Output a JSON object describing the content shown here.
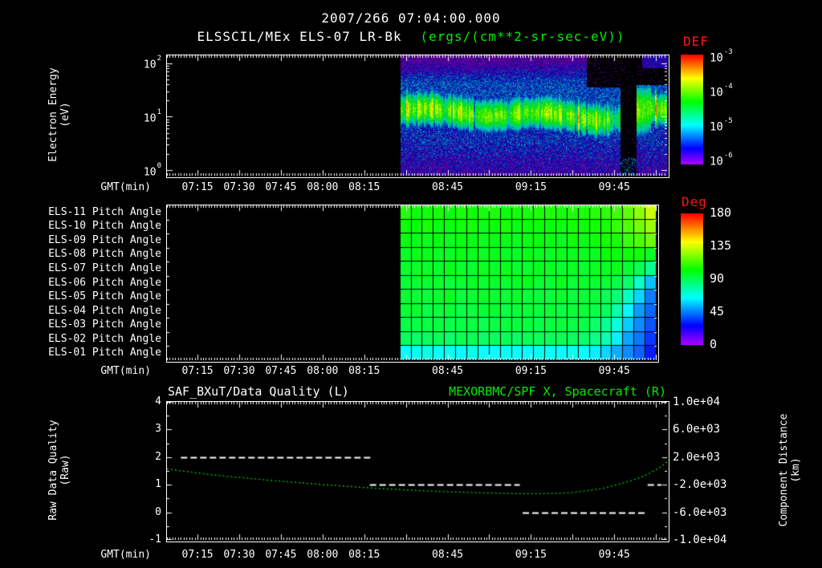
{
  "header": {
    "date_title": "2007/266 07:04:00.000",
    "plot_title": "ELSSCIL/MEx ELS-07 LR-Bk",
    "plot_units": "(ergs/(cm**2-sr-sec-eV))"
  },
  "colors": {
    "white": "#ffffff",
    "green": "#00ee00",
    "red": "#ff1515",
    "curve_green": "#00cc00"
  },
  "time_axis": {
    "label": "GMT(min)",
    "start": "07:04",
    "end": "10:04",
    "ticks": [
      "07:15",
      "07:30",
      "07:45",
      "08:00",
      "08:15",
      "08:45",
      "09:15",
      "09:45"
    ]
  },
  "chart_data": [
    {
      "id": "electron-energy-spectrogram",
      "type": "heatmap",
      "ylabel_line1": "Electron Energy",
      "ylabel_line2": "(eV)",
      "y_scale": "log10",
      "y_ticks_exp": [
        "2",
        "1",
        "0"
      ],
      "ylim_ev_log10": [
        -0.09,
        2.15
      ],
      "colorbar": {
        "label": "DEF",
        "ticks_exp": [
          "-3",
          "-4",
          "-5",
          "-6"
        ],
        "min_log10": -6,
        "max_log10": -3
      },
      "data_start": "08:28",
      "band": {
        "center_log10_ev_start": 1.13,
        "center_log10_ev_end": 0.98,
        "center_log10_ev_post_gap": 1.1,
        "sigma_log10": 0.2,
        "peak_log10_def": -4.05
      },
      "diffuse_log10_def": -5.35,
      "low_energy_log10_def": -5.5,
      "gap": {
        "start": "09:47",
        "end": "09:53"
      },
      "high_energy_cutoff": {
        "start": "09:35",
        "above_log10_ev": 1.55
      }
    },
    {
      "id": "pitch-angle-heatmap",
      "type": "heatmap",
      "row_labels": [
        "ELS-11 Pitch Angle",
        "ELS-10 Pitch Angle",
        "ELS-09 Pitch Angle",
        "ELS-08 Pitch Angle",
        "ELS-07 Pitch Angle",
        "ELS-06 Pitch Angle",
        "ELS-05 Pitch Angle",
        "ELS-04 Pitch Angle",
        "ELS-03 Pitch Angle",
        "ELS-02 Pitch Angle",
        "ELS-01 Pitch Angle"
      ],
      "colorbar": {
        "label": "Deg",
        "ticks": [
          180,
          135,
          90,
          45,
          0
        ],
        "min": 0,
        "max": 180
      },
      "data_start": "08:28",
      "values_deg": [
        [
          105,
          104,
          106,
          105,
          103,
          106,
          105,
          104,
          106,
          105,
          104,
          105,
          106,
          104,
          105,
          106,
          105,
          107,
          108,
          112,
          116,
          124,
          132
        ],
        [
          103,
          102,
          104,
          103,
          102,
          104,
          103,
          102,
          103,
          104,
          102,
          103,
          104,
          103,
          102,
          104,
          103,
          105,
          106,
          109,
          113,
          119,
          127
        ],
        [
          101,
          100,
          102,
          101,
          100,
          102,
          101,
          100,
          101,
          102,
          100,
          101,
          102,
          101,
          100,
          102,
          101,
          103,
          104,
          106,
          109,
          114,
          118
        ],
        [
          100,
          99,
          101,
          100,
          98,
          100,
          99,
          100,
          101,
          99,
          100,
          101,
          100,
          99,
          101,
          100,
          99,
          101,
          102,
          103,
          105,
          104,
          100
        ],
        [
          98,
          99,
          97,
          98,
          100,
          98,
          97,
          99,
          98,
          100,
          98,
          97,
          99,
          98,
          97,
          99,
          98,
          99,
          100,
          100,
          98,
          92,
          82
        ],
        [
          97,
          96,
          98,
          97,
          95,
          97,
          98,
          96,
          97,
          95,
          97,
          98,
          96,
          97,
          98,
          96,
          97,
          97,
          96,
          94,
          88,
          72,
          55
        ],
        [
          96,
          95,
          97,
          96,
          97,
          95,
          96,
          97,
          95,
          96,
          97,
          95,
          96,
          95,
          97,
          96,
          95,
          94,
          92,
          85,
          74,
          58,
          44
        ],
        [
          95,
          96,
          94,
          95,
          96,
          94,
          95,
          94,
          96,
          95,
          94,
          96,
          95,
          94,
          95,
          94,
          95,
          92,
          88,
          78,
          64,
          50,
          40
        ],
        [
          94,
          93,
          95,
          94,
          93,
          95,
          94,
          93,
          94,
          95,
          93,
          94,
          93,
          95,
          94,
          93,
          92,
          89,
          82,
          70,
          56,
          45,
          36
        ],
        [
          90,
          89,
          91,
          90,
          89,
          91,
          90,
          89,
          90,
          91,
          89,
          90,
          91,
          89,
          90,
          89,
          88,
          84,
          76,
          62,
          50,
          42,
          33
        ],
        [
          66,
          64,
          67,
          65,
          66,
          64,
          67,
          65,
          64,
          66,
          65,
          64,
          66,
          65,
          64,
          66,
          64,
          62,
          58,
          52,
          46,
          40,
          30
        ]
      ]
    },
    {
      "id": "quality-and-distance",
      "type": "line",
      "title_left": "SAF_BXuT/Data Quality (L)",
      "title_right": "MEXORBMC/SPF X, Spacecraft (R)",
      "ylabel_left_line1": "Raw Data Quality",
      "ylabel_left_line2": "(Raw)",
      "ylabel_right_line1": "Component Distance",
      "ylabel_right_line2": "(km)",
      "ylim_left": [
        -1,
        4
      ],
      "y_ticks_left": [
        4,
        3,
        2,
        1,
        0,
        -1
      ],
      "ylim_right": [
        -10000,
        10000
      ],
      "y_ticks_right": [
        [
          "1.0e+04",
          10000
        ],
        [
          "6.0e+03",
          6000
        ],
        [
          "2.0e+03",
          2000
        ],
        [
          "-2.0e+03",
          -2000
        ],
        [
          "-6.0e+03",
          -6000
        ],
        [
          "-1.0e+04",
          -10000
        ]
      ],
      "series": [
        {
          "name": "SAF_BXuT/Data Quality",
          "axis": "left",
          "color": "#ffffff",
          "style": "dashed",
          "segments": [
            [
              "07:09",
              "08:18",
              2
            ],
            [
              "08:17",
              "09:11",
              1
            ],
            [
              "09:12",
              "09:56",
              0
            ],
            [
              "09:57",
              "10:02",
              1
            ]
          ]
        },
        {
          "name": "MEXORBMC/SPF X Spacecraft",
          "axis": "right",
          "color": "#00cc00",
          "style": "dotted",
          "points": [
            [
              "07:04",
              300
            ],
            [
              "07:20",
              -560
            ],
            [
              "07:40",
              -1320
            ],
            [
              "08:00",
              -1980
            ],
            [
              "08:20",
              -2540
            ],
            [
              "08:40",
              -2950
            ],
            [
              "09:00",
              -3200
            ],
            [
              "09:10",
              -3290
            ],
            [
              "09:20",
              -3300
            ],
            [
              "09:30",
              -3130
            ],
            [
              "09:40",
              -2600
            ],
            [
              "09:48",
              -1800
            ],
            [
              "09:54",
              -1000
            ],
            [
              "09:58",
              -300
            ],
            [
              "10:01",
              400
            ],
            [
              "10:04",
              1300
            ]
          ]
        }
      ]
    }
  ]
}
